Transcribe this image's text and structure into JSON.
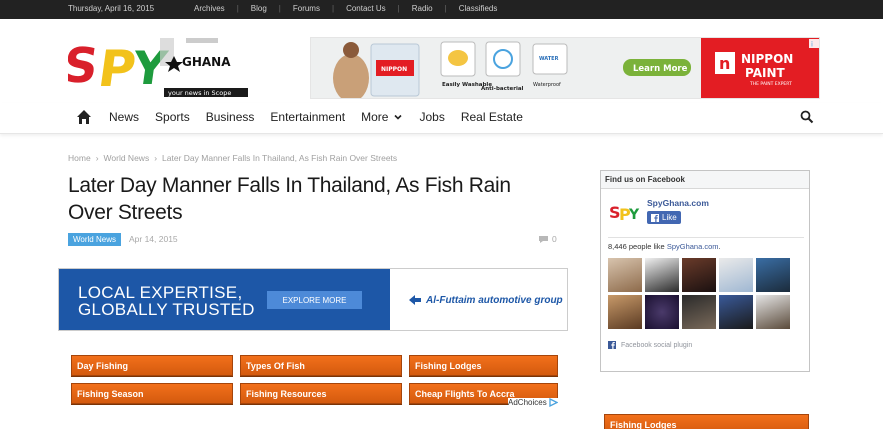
{
  "topbar": {
    "date": "Thursday, April 16, 2015",
    "links": [
      "Archives",
      "Blog",
      "Forums",
      "Contact Us",
      "Radio",
      "Classifieds"
    ]
  },
  "logo": {
    "text": "SPY",
    "country": "GHANA",
    "tagline": "your news in Scope"
  },
  "top_ad": {
    "brand": "NIPPON PAINT",
    "brand_sub": "THE PAINT EXPERT",
    "features": [
      "Easily Washable",
      "Anti-bacterial",
      "Waterproof"
    ],
    "cta": "Learn More"
  },
  "nav": {
    "items": [
      "News",
      "Sports",
      "Business",
      "Entertainment",
      "More",
      "Jobs",
      "Real Estate"
    ],
    "icons": [
      "home-icon",
      "chevron-down-icon",
      "search-icon"
    ]
  },
  "breadcrumb": [
    "Home",
    "World News",
    "Later Day Manner Falls In Thailand, As Fish Rain Over Streets"
  ],
  "article": {
    "title": "Later Day Manner Falls In Thailand, As Fish Rain Over Streets",
    "category": "World News",
    "date": "Apr 14, 2015",
    "comments": "0"
  },
  "banner_ad": {
    "line1": "LOCAL EXPERTISE,",
    "line2": "GLOBALLY TRUSTED",
    "button": "EXPLORE MORE",
    "sponsor": "Al-Futtaim automotive group"
  },
  "ad_links": [
    "Day Fishing",
    "Types Of Fish",
    "Fishing Lodges",
    "Fishing Season",
    "Fishing Resources",
    "Cheap Flights To Accra"
  ],
  "adchoices": "AdChoices",
  "facebook": {
    "header": "Find us on Facebook",
    "page_name": "SpyGhana.com",
    "like": "Like",
    "count_text": "8,446 people like",
    "count_link": "SpyGhana.com",
    "count_end": ".",
    "plugin": "Facebook social plugin"
  },
  "sidebar_ad": "Fishing Lodges",
  "colors": {
    "topbar": "#222222",
    "accent_blue": "#4aa3df",
    "ad_orange": "#e8661a",
    "fb_blue": "#3b5998",
    "banner_blue": "#1d57a7",
    "nippon_red": "#e31d23"
  }
}
